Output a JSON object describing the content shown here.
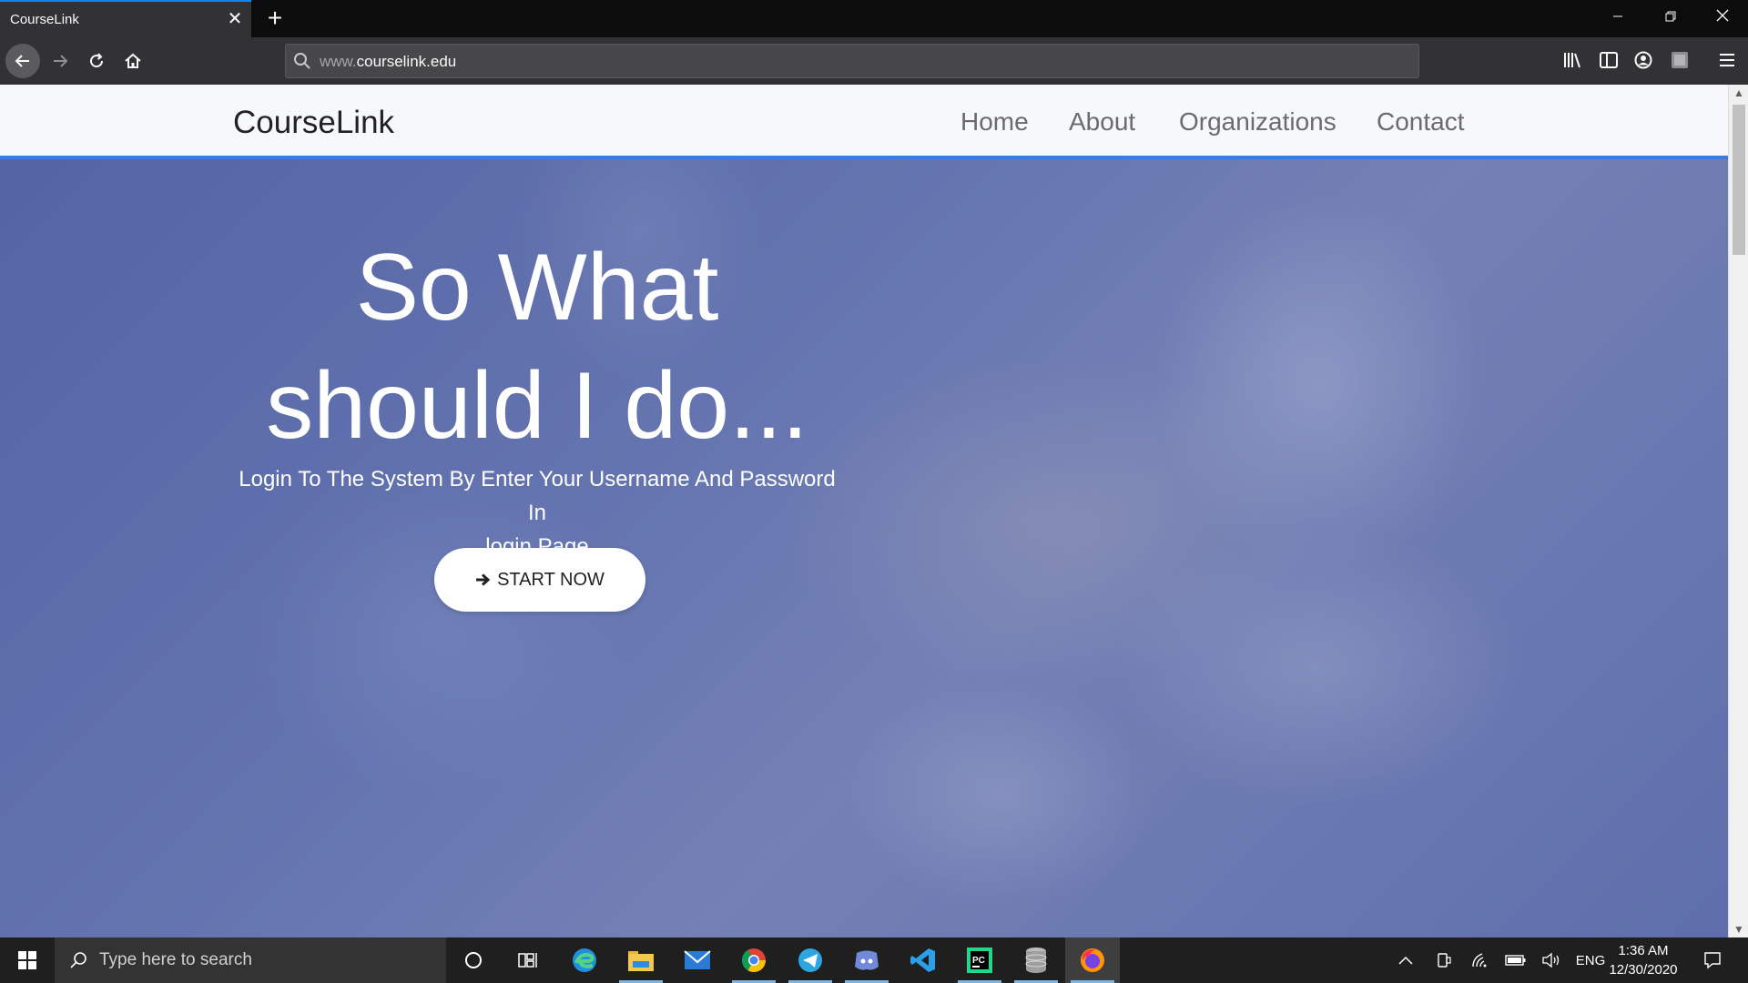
{
  "browser": {
    "tab_title": "CourseLink",
    "tab_close": "✕",
    "new_tab": "+",
    "url_prefix": "www.",
    "url_domain": "courselink.edu"
  },
  "site": {
    "brand": "CourseLink",
    "nav": [
      "Home",
      "About",
      "Organizations",
      "Contact"
    ]
  },
  "hero": {
    "headline_line1": "So What",
    "headline_line2": "should I do...",
    "subtitle_line1": "Login To The System By Enter Your Username And Password In",
    "subtitle_line2": "login Page",
    "cta_label": "START NOW"
  },
  "taskbar": {
    "search_placeholder": "Type here to search",
    "language": "ENG",
    "time": "1:36 AM",
    "date": "12/30/2020",
    "apps": [
      "cortana-icon",
      "task-view-icon",
      "edge-icon",
      "file-explorer-icon",
      "mail-icon",
      "chrome-icon",
      "telegram-icon",
      "discord-icon",
      "vscode-icon",
      "pycharm-icon",
      "database-icon",
      "firefox-icon"
    ]
  },
  "colors": {
    "accent": "#3c7be0",
    "browser_dark": "#323234",
    "hero_tint": "#5a6aa5"
  }
}
